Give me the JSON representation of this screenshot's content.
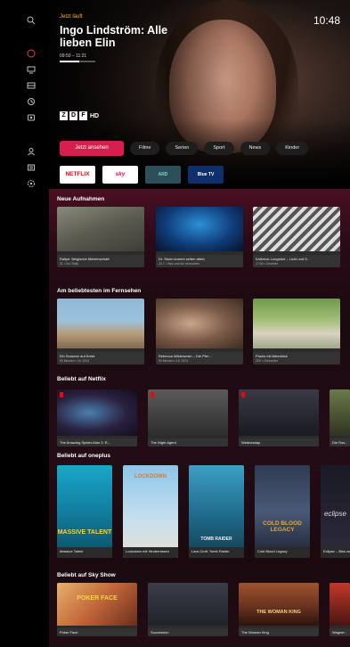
{
  "hero": {
    "live_label": "Jetzt läuft",
    "title": "Ingo Lindström: Alle lieben Elin",
    "time": "09:50 – 11:21",
    "progress": 0.55,
    "clock": "10:48",
    "channel": {
      "logo_letters": [
        "Z",
        "D",
        "F"
      ],
      "suffix": "HD"
    }
  },
  "cta": {
    "primary_label": "Jetzt ansehen",
    "chips": [
      "Filme",
      "Serien",
      "Sport",
      "News",
      "Kinder"
    ]
  },
  "providers": [
    "NETFLIX",
    "sky",
    "ARD",
    "Blue TV"
  ],
  "sidebar": {
    "icons": [
      "search-icon",
      "home-icon",
      "tv-icon",
      "guide-icon",
      "replay-icon",
      "recordings-icon",
      "profile-icon",
      "list-icon",
      "settings-icon"
    ],
    "active": "home-icon"
  },
  "rows": [
    {
      "title": "Neue Aufnahmen",
      "items": [
        {
          "title": "Rallye: Belgische Meisterschaft",
          "sub": "21 • Vol. Rally"
        },
        {
          "title": "Dr. Stulm kommt selten allein",
          "sub": "20.7. • Neu und die Verrückten"
        },
        {
          "title": "Kalkreck-Lungebot – Licht und S…",
          "sub": "17:00 • Gesehen"
        }
      ]
    },
    {
      "title": "Am beliebtesten im Fernsehen",
      "items": [
        {
          "title": "Ein Sommer auf Kreta",
          "sub": "90 Minuten • 16. 2024"
        },
        {
          "title": "Rebecca Wildersesin – Die Pfer…",
          "sub": "90 Minuten • 15. 2024"
        },
        {
          "title": "Praxis mit Meerblick",
          "sub": "ZDF • Schneider"
        }
      ]
    },
    {
      "title": "Beliebt auf Netflix",
      "items": [
        {
          "title": "The Amazing Spider-Man 2: R…"
        },
        {
          "title": "The Night Agent"
        },
        {
          "title": "Wednesday"
        },
        {
          "title": "Die Ros…"
        }
      ]
    },
    {
      "title": "Beliebt auf oneplus",
      "items": [
        {
          "title": "Massive Talent",
          "art": "MASSIVE TALENT"
        },
        {
          "title": "Lockdown mit Hindernissen",
          "art": "LOCKDOWN"
        },
        {
          "title": "Lara Croft: Tomb Raider",
          "art": "TOMB RAIDER"
        },
        {
          "title": "Cold Blood Legacy",
          "art": "COLD BLOOD LEGACY"
        },
        {
          "title": "Eclipse – Biss zum Abendrot",
          "art": "eclipse"
        }
      ]
    },
    {
      "title": "Beliebt auf Sky Show",
      "items": [
        {
          "title": "Poker Face",
          "art": "POKER FACE"
        },
        {
          "title": "Succession"
        },
        {
          "title": "The Woman King",
          "art": "THE WOMAN KING"
        },
        {
          "title": "Wagner…"
        }
      ]
    }
  ]
}
